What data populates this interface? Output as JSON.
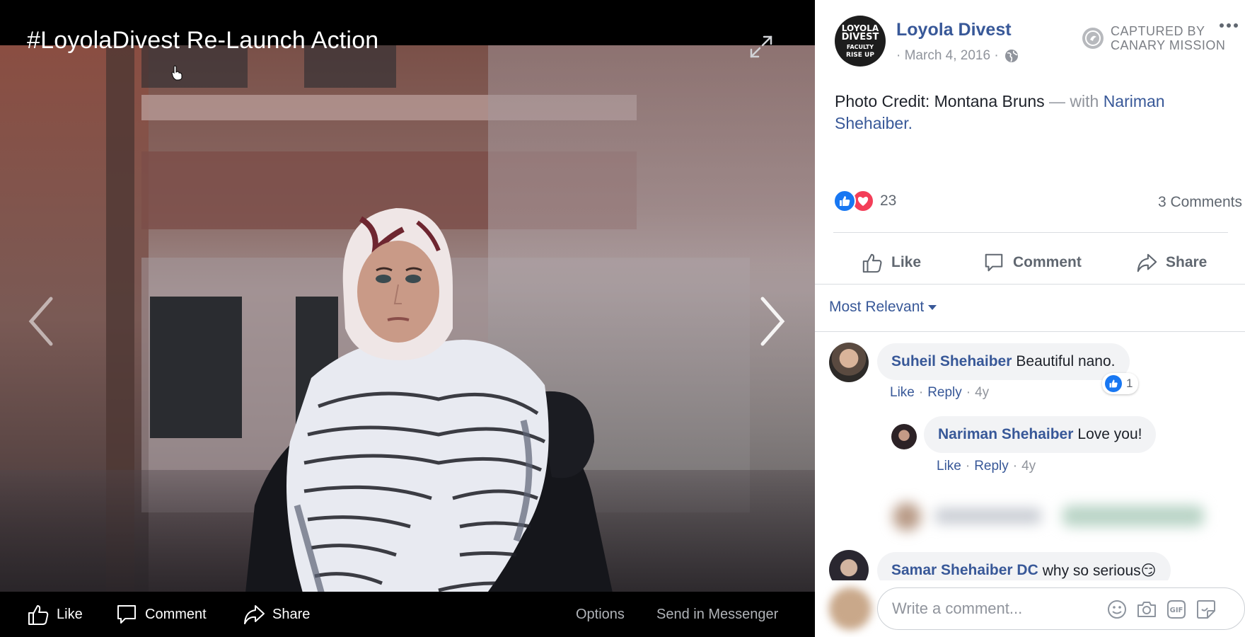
{
  "viewer": {
    "title": "#LoyolaDivest Re-Launch Action",
    "bar": {
      "like": "Like",
      "comment": "Comment",
      "share": "Share",
      "options": "Options",
      "send": "Send in Messenger"
    }
  },
  "post": {
    "page_name": "Loyola Divest",
    "avatar_lines": [
      "LOYOLA",
      "DIVEST",
      "FACULTY",
      "RISE UP"
    ],
    "date": "· March 4, 2016 ·",
    "captured_line1": "CAPTURED BY",
    "captured_line2": "CANARY MISSION",
    "caption_text": "Photo Credit: Montana Bruns",
    "caption_dash": " — with ",
    "caption_tag": "Nariman Shehaiber.",
    "reaction_count": "23",
    "comments_count": "3 Comments",
    "actions": {
      "like": "Like",
      "comment": "Comment",
      "share": "Share"
    },
    "sort_label": "Most Relevant"
  },
  "comments": [
    {
      "author": "Suheil Shehaiber",
      "text": "Beautiful nano.",
      "like": "Like",
      "reply": "Reply",
      "time": "4y",
      "reactions": "1"
    },
    {
      "author": "Nariman Shehaiber",
      "text": "Love you!",
      "like": "Like",
      "reply": "Reply",
      "time": "4y"
    },
    {
      "author": "Samar Shehaiber DC",
      "text": "why so serious😏"
    }
  ],
  "composer": {
    "placeholder": "Write a comment..."
  },
  "colors": {
    "link": "#385898",
    "like_blue": "#1877f2",
    "love_red": "#f33e58"
  }
}
